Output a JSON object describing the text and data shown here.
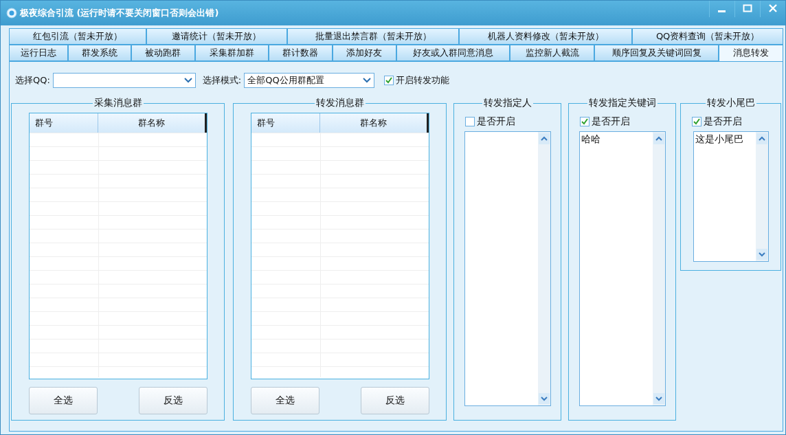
{
  "window": {
    "title": "极夜综合引流 (运行时请不要关闭窗口否则会出错)"
  },
  "tab_rows": [
    [
      {
        "label": "红包引流（暂未开放）",
        "selected": false
      },
      {
        "label": "邀请统计（暂未开放）",
        "selected": false
      },
      {
        "label": "批量退出禁言群（暂未开放）",
        "selected": false
      },
      {
        "label": "机器人资料修改（暂未开放）",
        "selected": false
      },
      {
        "label": "QQ资料查询（暂未开放）",
        "selected": false
      }
    ],
    [
      {
        "label": "运行日志",
        "selected": false
      },
      {
        "label": "群发系统",
        "selected": false
      },
      {
        "label": "被动跑群",
        "selected": false
      },
      {
        "label": "采集群加群",
        "selected": false
      },
      {
        "label": "群计数器",
        "selected": false
      },
      {
        "label": "添加好友",
        "selected": false
      },
      {
        "label": "好友或入群同意消息",
        "selected": false
      },
      {
        "label": "监控新人截流",
        "selected": false
      },
      {
        "label": "顺序回复及关键词回复",
        "selected": false
      },
      {
        "label": "消息转发",
        "selected": true
      }
    ]
  ],
  "toolbar": {
    "qq_label": "选择QQ:",
    "mode_label": "选择模式:",
    "mode_value": "全部QQ公用群配置",
    "forward": {
      "label": "开启转发功能",
      "checked": true
    }
  },
  "group_lists": [
    {
      "title": "采集消息群",
      "columns": [
        "群号",
        "群名称"
      ],
      "buttons": [
        "全选",
        "反选"
      ]
    },
    {
      "title": "转发消息群",
      "columns": [
        "群号",
        "群名称"
      ],
      "buttons": [
        "全选",
        "反选"
      ]
    }
  ],
  "text_groups": [
    {
      "title": "转发指定人",
      "enable": {
        "label": "是否开启",
        "checked": false
      }
    },
    {
      "title": "转发指定关键词",
      "enable": {
        "label": "是否开启",
        "checked": true
      },
      "value": "哈哈"
    },
    {
      "title": "转发小尾巴",
      "enable": {
        "label": "是否开启",
        "checked": true
      },
      "value": "这是小尾巴"
    }
  ]
}
